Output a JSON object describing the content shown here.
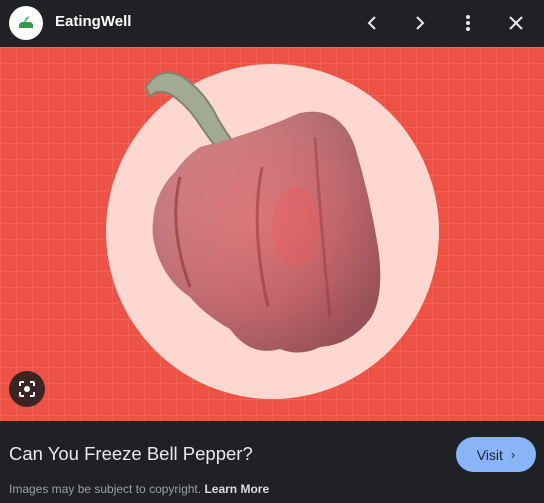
{
  "header": {
    "site_name": "EatingWell",
    "logo_icon": "eatingwell-leaf-logo-icon",
    "prev_icon": "chevron-left-icon",
    "next_icon": "chevron-right-icon",
    "more_icon": "more-vert-icon",
    "close_icon": "close-icon"
  },
  "image": {
    "subject": "frozen red bell pepper",
    "lens_icon": "google-lens-icon",
    "colors": {
      "background": "#ee5245",
      "circle": "#fdd7d0"
    }
  },
  "caption": {
    "title": "Can You Freeze Bell Pepper?",
    "visit_label": "Visit",
    "copyright_text": "Images may be subject to copyright.",
    "learn_more": "Learn More"
  },
  "colors": {
    "visit_button": "#8ab4f8",
    "panel_bg": "#202124"
  }
}
